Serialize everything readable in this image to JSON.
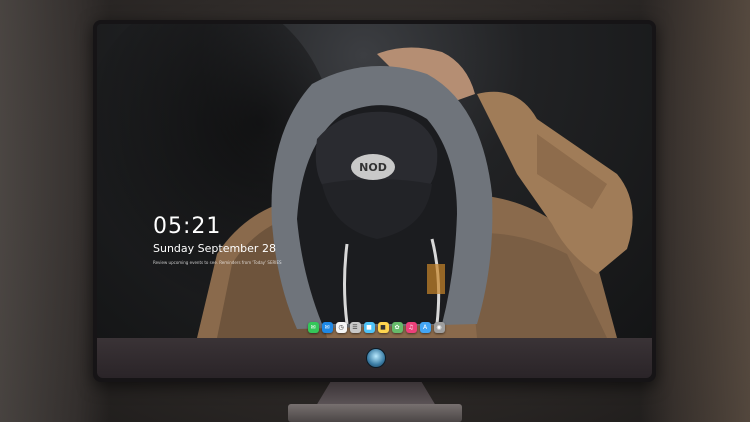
{
  "lock_screen": {
    "time": "05:21",
    "date": "Sunday September  28",
    "note": "Review upcoming events to see. Reminders from 'Today' SERIES"
  },
  "dock": {
    "items": [
      {
        "icon": "messages-icon",
        "color": "#34c759"
      },
      {
        "icon": "mail-icon",
        "color": "#1e88e5"
      },
      {
        "icon": "clock-icon",
        "color": "#f5f5f5"
      },
      {
        "icon": "notes-icon",
        "color": "#c8c8c8"
      },
      {
        "icon": "finder-icon",
        "color": "#4fc3f7"
      },
      {
        "icon": "stickies-icon",
        "color": "#ffd54f"
      },
      {
        "icon": "photos-icon",
        "color": "#66bb6a"
      },
      {
        "icon": "music-icon",
        "color": "#ec407a"
      },
      {
        "icon": "appstore-icon",
        "color": "#42a5f5"
      },
      {
        "icon": "camera-icon",
        "color": "#9e9e9e"
      }
    ]
  },
  "monitor": {
    "logo_icon": "alien-logo-icon"
  }
}
